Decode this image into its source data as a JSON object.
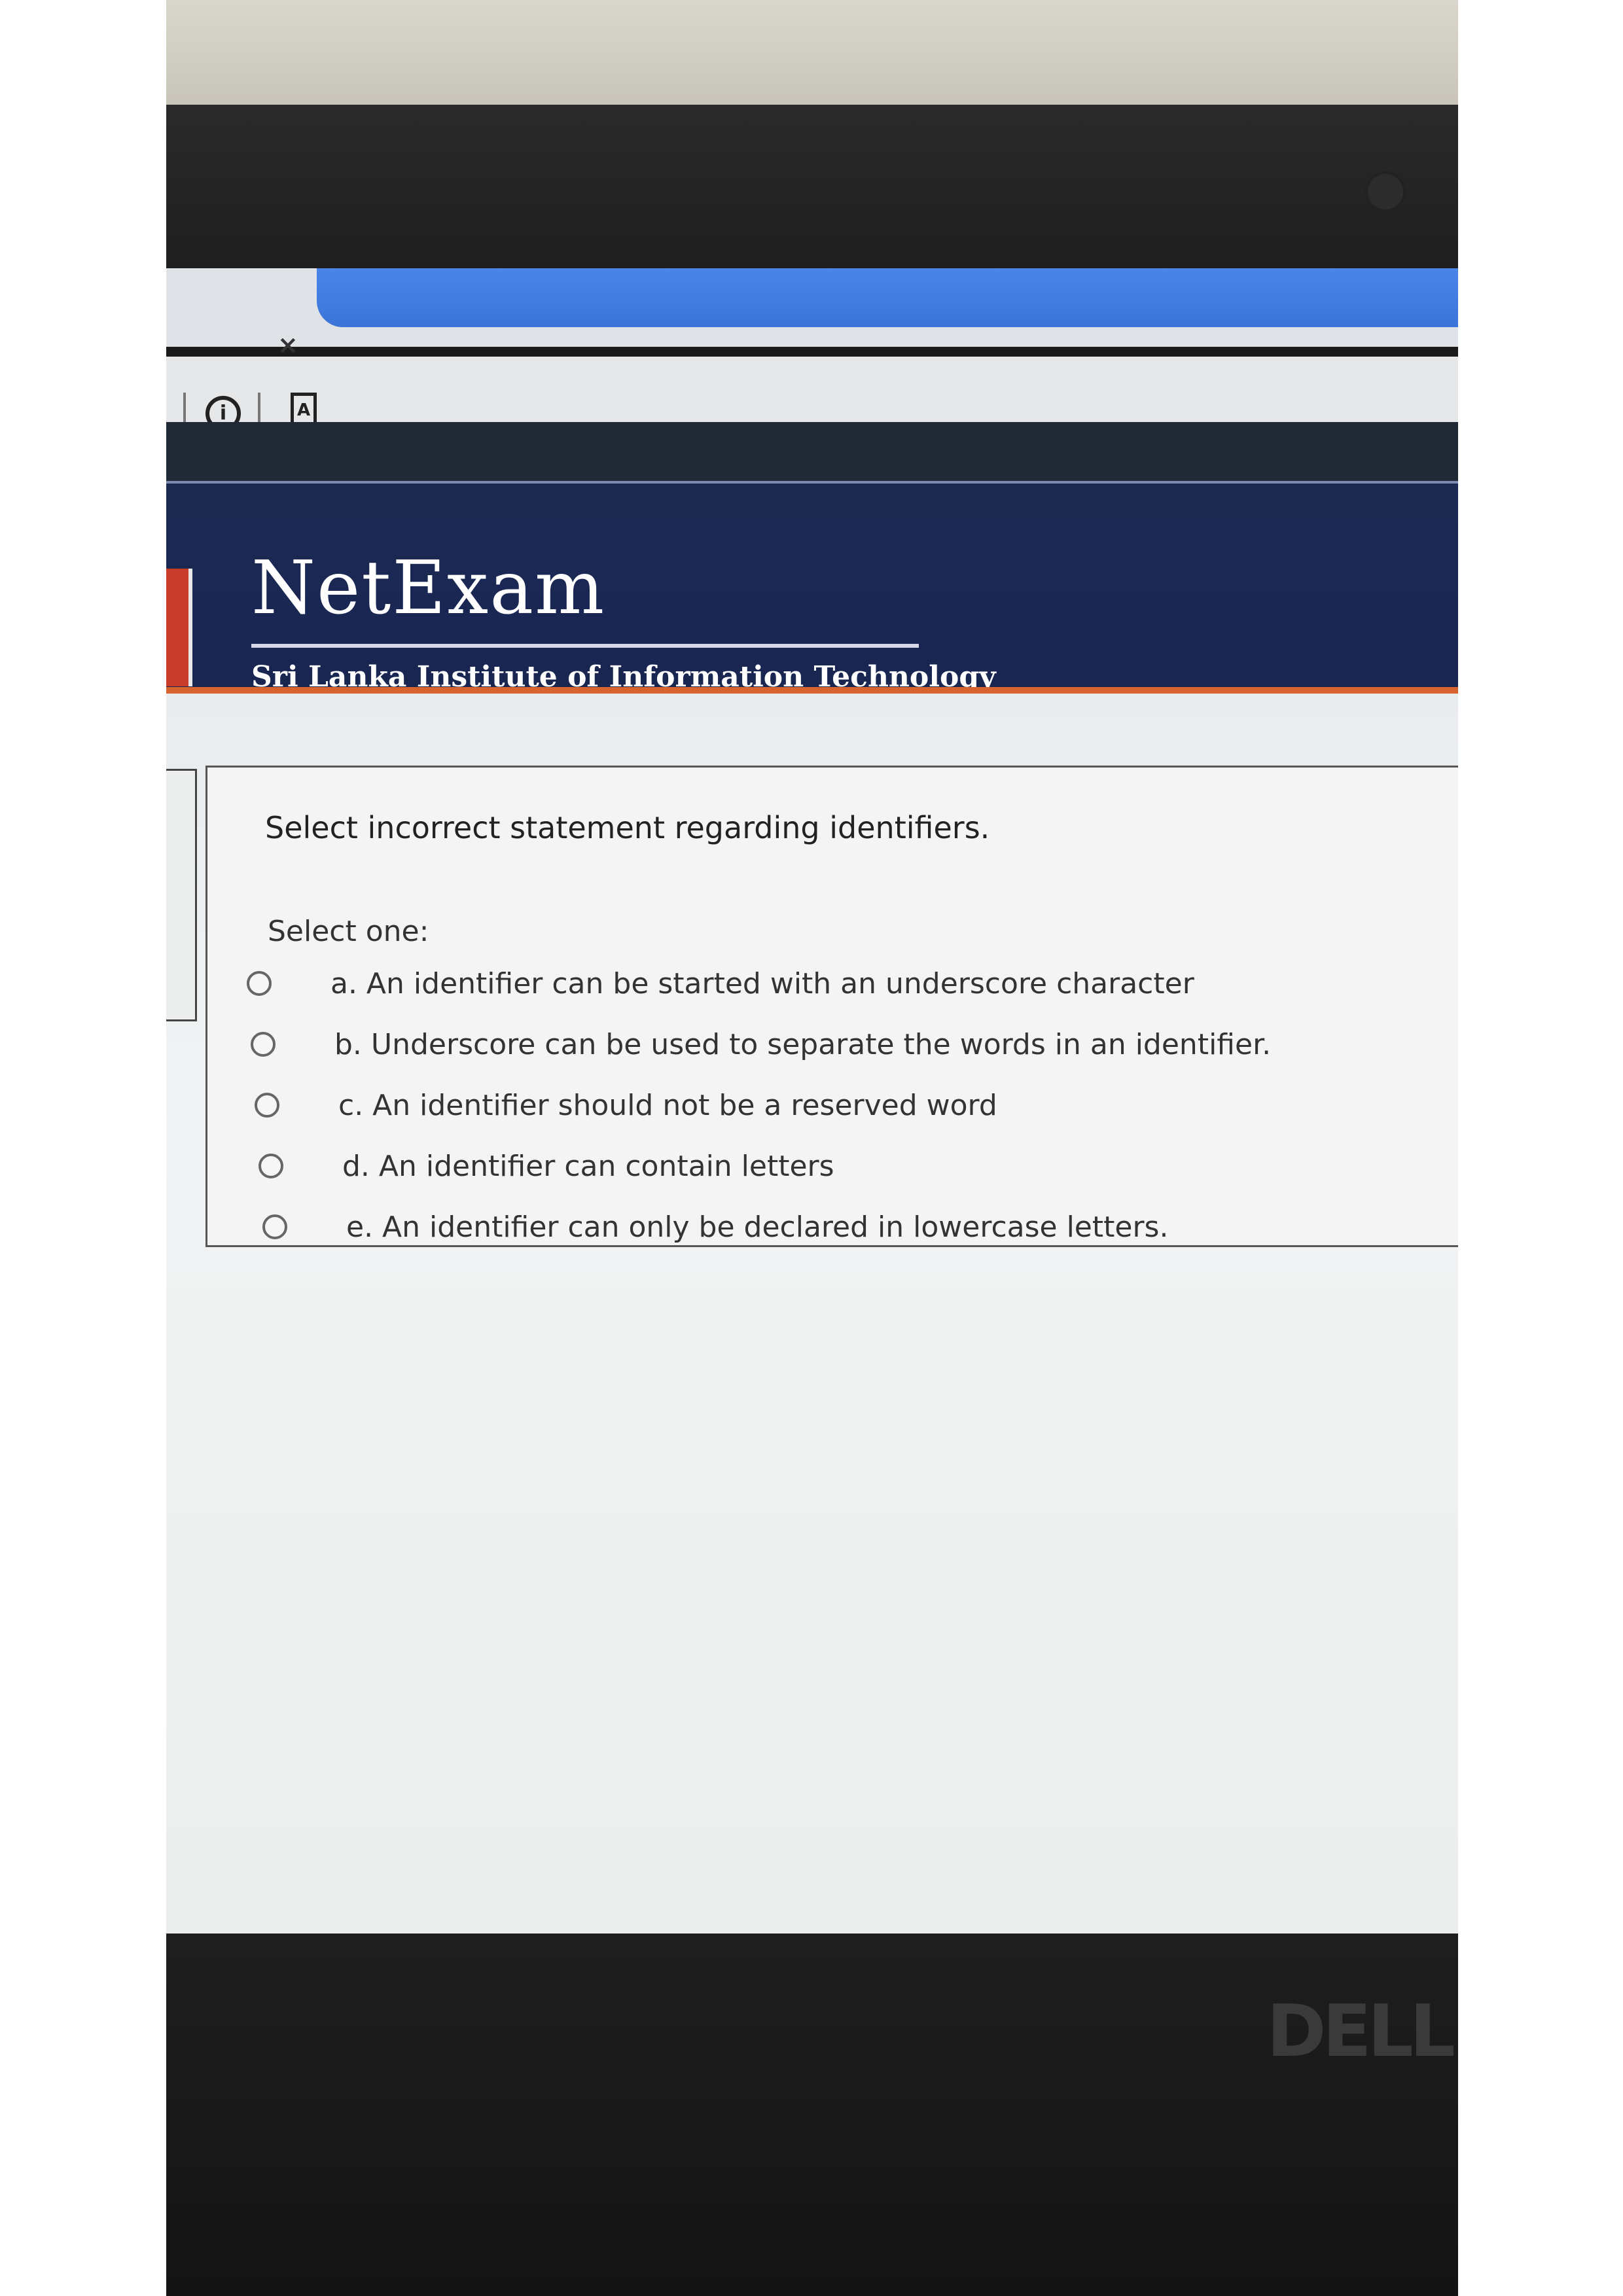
{
  "browser": {
    "tab_close": "×",
    "info_icon_glyph": "i",
    "pdf_icon_glyph": "A"
  },
  "header": {
    "brand": "NetExam",
    "institute": "Sri Lanka Institute of Information Technology"
  },
  "quiz": {
    "question": "Select incorrect statement regarding identifiers.",
    "select_prompt": "Select one:",
    "options": [
      "a. An identifier can be started with an underscore character",
      "b. Underscore can be used to separate the words in an identifier.",
      "c. An identifier should not be a reserved word",
      "d. An identifier can contain letters",
      "e. An identifier can only be declared in lowercase letters."
    ],
    "selected": null
  },
  "device": {
    "logo": "DELL"
  },
  "colors": {
    "header_bg": "#1c2a52",
    "accent": "#d7632f",
    "tab_blue": "#4a86e8"
  }
}
